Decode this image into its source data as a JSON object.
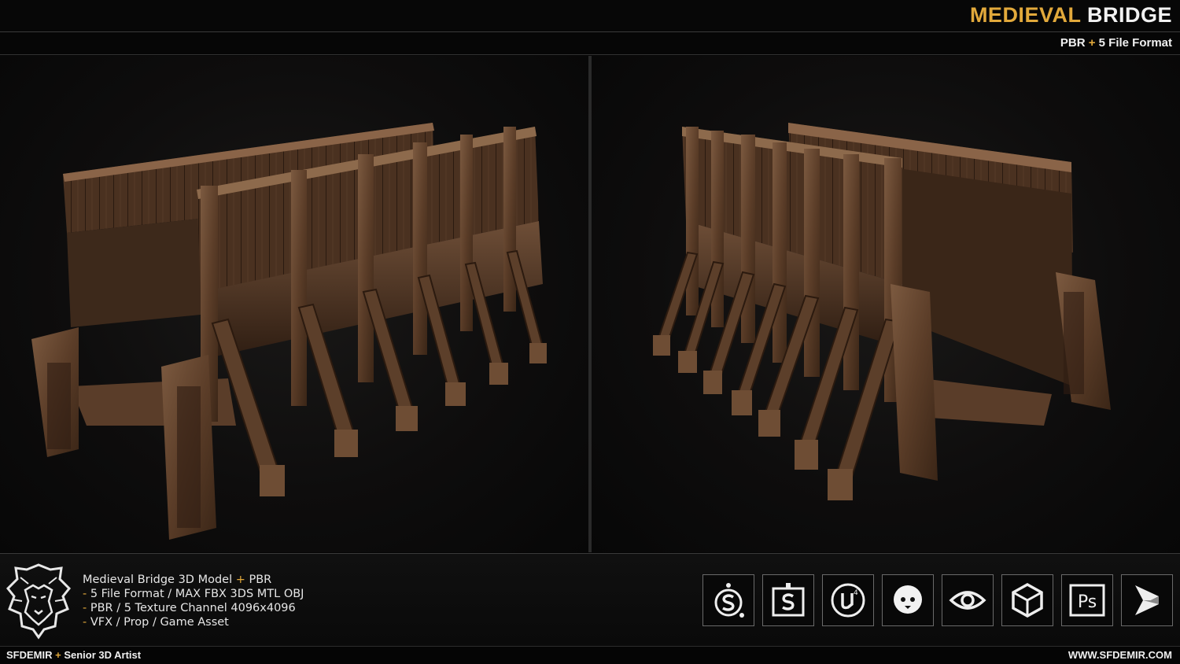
{
  "header": {
    "title_word1": "MEDIEVAL",
    "title_word2": "BRIDGE",
    "subtitle_part1": "PBR",
    "subtitle_plus": "+",
    "subtitle_part2": "5 File Format"
  },
  "description": {
    "line1_main": "Medieval Bridge 3D Model",
    "line1_plus": "+",
    "line1_end": "PBR",
    "bullet": "-",
    "line2": "5 File Format / MAX FBX 3DS MTL OBJ",
    "line3": "PBR / 5 Texture Channel 4096x4096",
    "line4": "VFX / Prop / Game Asset"
  },
  "software_icons": [
    "substance-painter-icon",
    "substance-designer-icon",
    "unreal-engine-icon",
    "marmoset-icon",
    "eye-viewer-icon",
    "unity-icon",
    "photoshop-icon",
    "3ds-max-icon"
  ],
  "photoshop_label": "Ps",
  "unreal_label": "4",
  "footer": {
    "author_name": "SFDEMIR",
    "author_plus": "+",
    "author_role": "Senior 3D Artist",
    "website": "WWW.SFDEMIR.COM"
  },
  "colors": {
    "accent": "#e2a93b",
    "wood_dark": "#3a2516",
    "wood_mid": "#6b4a32",
    "wood_light": "#8a6448"
  }
}
